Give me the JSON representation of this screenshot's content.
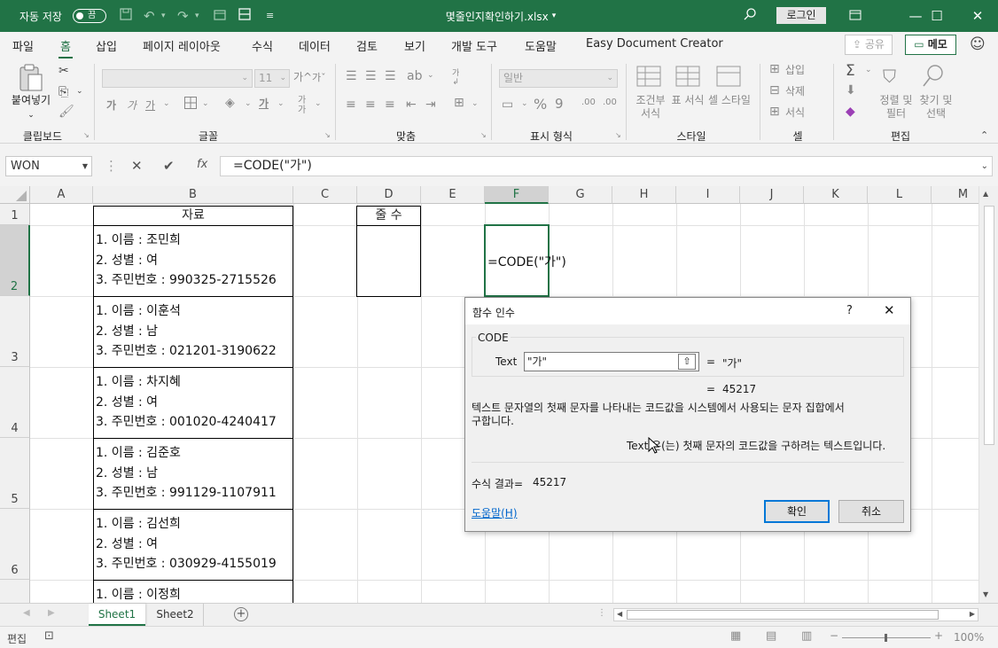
{
  "titlebar": {
    "autosave_label": "자동 저장",
    "autosave_state": "끔",
    "filename": "몇줄인지확인하기.xlsx",
    "login_label": "로그인",
    "icons": [
      "save-icon",
      "undo-icon",
      "redo-icon",
      "new-icon",
      "form-icon",
      "customize-icon",
      "search-icon",
      "ribbon-display-icon",
      "minimize-icon",
      "maximize-icon",
      "close-icon"
    ]
  },
  "menu": {
    "tabs": [
      "파일",
      "홈",
      "삽입",
      "페이지 레이아웃",
      "수식",
      "데이터",
      "검토",
      "보기",
      "개발 도구",
      "도움말",
      "Easy Document Creator"
    ],
    "active_tab": "홈",
    "share_label": "공유",
    "memo_label": "메모"
  },
  "ribbon": {
    "clipboard": {
      "paste_label": "붙여넣기",
      "group_label": "클립보드"
    },
    "font": {
      "font_size": "11",
      "group_label": "글꼴",
      "bold": "가",
      "italic": "가",
      "underline": "가",
      "grow": "가",
      "shrink": "가",
      "phonetic": "가"
    },
    "alignment": {
      "wrap": "가",
      "merge": "내",
      "group_label": "맞춤"
    },
    "number": {
      "format": "일반",
      "group_label": "표시 형식"
    },
    "styles": {
      "conditional": "조건부 서식",
      "table": "표 서식",
      "cell": "셀 스타일",
      "group_label": "스타일"
    },
    "cells": {
      "insert": "삽입",
      "delete": "삭제",
      "format": "서식",
      "group_label": "셀"
    },
    "editing": {
      "sort": "정렬 및 필터",
      "find": "찾기 및 선택",
      "group_label": "편집"
    }
  },
  "formula_bar": {
    "name_box": "WON",
    "formula": "=CODE(\"가\")",
    "fx_label": "fx"
  },
  "grid": {
    "columns": [
      "A",
      "B",
      "C",
      "D",
      "E",
      "F",
      "G",
      "H",
      "I",
      "J",
      "K",
      "L",
      "M"
    ],
    "selected_column": "F",
    "rows": [
      "1",
      "2",
      "3",
      "4",
      "5",
      "6"
    ],
    "selected_row": "2",
    "b1_header": "자료",
    "d1_header": "줄 수",
    "f2_formula": "=CODE(\"가\")",
    "records": [
      {
        "line1": "1. 이름 : 조민희",
        "line2": "2. 성별 : 여",
        "line3": "3. 주민번호 : 990325-2715526"
      },
      {
        "line1": "1. 이름 : 이훈석",
        "line2": "2. 성별 : 남",
        "line3": "3. 주민번호 : 021201-3190622"
      },
      {
        "line1": "1. 이름 : 차지혜",
        "line2": "2. 성별 : 여",
        "line3": "3. 주민번호 : 001020-4240417"
      },
      {
        "line1": "1. 이름 : 김준호",
        "line2": "2. 성별 : 남",
        "line3": "3. 주민번호 : 991129-1107911"
      },
      {
        "line1": "1. 이름 : 김선희",
        "line2": "2. 성별 : 여",
        "line3": "3. 주민번호 : 030929-4155019"
      },
      {
        "line1": "1. 이름 : 이정희"
      }
    ]
  },
  "sheets": {
    "tabs": [
      "Sheet1",
      "Sheet2"
    ],
    "active": "Sheet1"
  },
  "status": {
    "mode": "편집",
    "zoom": "100%"
  },
  "dialog": {
    "title": "함수 인수",
    "help_mark": "?",
    "function_name": "CODE",
    "arg_label": "Text",
    "arg_value": "\"가\"",
    "arg_eq": "=",
    "arg_result": "\"가\"",
    "result_eq": "=",
    "result_value": "45217",
    "description_line1": "텍스트 문자열의 첫째 문자를 나타내는 코드값을 시스템에서 사용되는 문자 집합에서",
    "description_line2": "구합니다.",
    "arg_description": "Text 은(는) 첫째 문자의 코드값을 구하려는 텍스트입니다.",
    "formula_result_label": "수식 결과=",
    "formula_result_value": "45217",
    "help_link": "도움말(H)",
    "ok_label": "확인",
    "cancel_label": "취소"
  }
}
